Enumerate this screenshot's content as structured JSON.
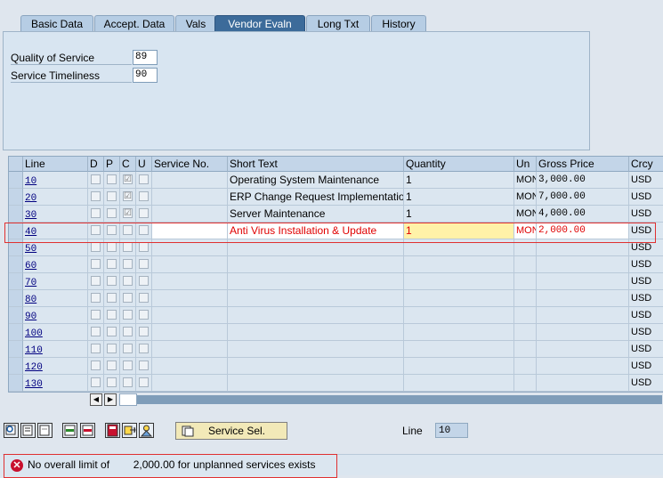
{
  "tabs": [
    "Basic Data",
    "Accept. Data",
    "Vals",
    "Vendor Evaln",
    "Long Txt",
    "History"
  ],
  "active_tab": "Vendor Evaln",
  "vendor_eval": {
    "quality_label": "Quality of Service",
    "quality_value": "89",
    "timeliness_label": "Service Timeliness",
    "timeliness_value": "90"
  },
  "table": {
    "headers": [
      "Line",
      "D",
      "P",
      "C",
      "U",
      "Service No.",
      "Short Text",
      "Quantity",
      "Un",
      "Gross Price",
      "Crcy"
    ],
    "rows": [
      {
        "line": "10",
        "c_checked": "☑",
        "service_no": "",
        "text": "Operating System Maintenance",
        "qty": "1",
        "un": "MON",
        "price": "3,000.00",
        "crcy": "USD"
      },
      {
        "line": "20",
        "c_checked": "☑",
        "service_no": "",
        "text": "ERP Change Request Implementation",
        "qty": "1",
        "un": "MON",
        "price": "7,000.00",
        "crcy": "USD"
      },
      {
        "line": "30",
        "c_checked": "☑",
        "service_no": "",
        "text": "Server Maintenance",
        "qty": "1",
        "un": "MON",
        "price": "4,000.00",
        "crcy": "USD"
      },
      {
        "line": "40",
        "c_checked": "",
        "service_no": "",
        "text": "Anti Virus Installation & Update",
        "qty": "1",
        "un": "MON",
        "price": "2,000.00",
        "crcy": "USD"
      },
      {
        "line": "50",
        "c_checked": "",
        "service_no": "",
        "text": "",
        "qty": "",
        "un": "",
        "price": "",
        "crcy": "USD"
      },
      {
        "line": "60",
        "c_checked": "",
        "service_no": "",
        "text": "",
        "qty": "",
        "un": "",
        "price": "",
        "crcy": "USD"
      },
      {
        "line": "70",
        "c_checked": "",
        "service_no": "",
        "text": "",
        "qty": "",
        "un": "",
        "price": "",
        "crcy": "USD"
      },
      {
        "line": "80",
        "c_checked": "",
        "service_no": "",
        "text": "",
        "qty": "",
        "un": "",
        "price": "",
        "crcy": "USD"
      },
      {
        "line": "90",
        "c_checked": "",
        "service_no": "",
        "text": "",
        "qty": "",
        "un": "",
        "price": "",
        "crcy": "USD"
      },
      {
        "line": "100",
        "c_checked": "",
        "service_no": "",
        "text": "",
        "qty": "",
        "un": "",
        "price": "",
        "crcy": "USD"
      },
      {
        "line": "110",
        "c_checked": "",
        "service_no": "",
        "text": "",
        "qty": "",
        "un": "",
        "price": "",
        "crcy": "USD"
      },
      {
        "line": "120",
        "c_checked": "",
        "service_no": "",
        "text": "",
        "qty": "",
        "un": "",
        "price": "",
        "crcy": "USD"
      },
      {
        "line": "130",
        "c_checked": "",
        "service_no": "",
        "text": "",
        "qty": "",
        "un": "",
        "price": "",
        "crcy": "USD"
      }
    ]
  },
  "toolbar": {
    "service_sel_label": "Service Sel.",
    "line_label": "Line",
    "line_value": "10",
    "icons": [
      "select-all-icon",
      "details-icon",
      "deselect-icon",
      "insert-row-icon",
      "delete-row-icon",
      "calculator-icon",
      "copy-icon",
      "person-icon",
      "service-select-icon"
    ]
  },
  "status": {
    "message": "No overall limit of        2,000.00 for unplanned services exists"
  },
  "colors": {
    "highlight": "#e03030",
    "active_tab": "#3c6b9a",
    "error_red": "#c8102e"
  }
}
